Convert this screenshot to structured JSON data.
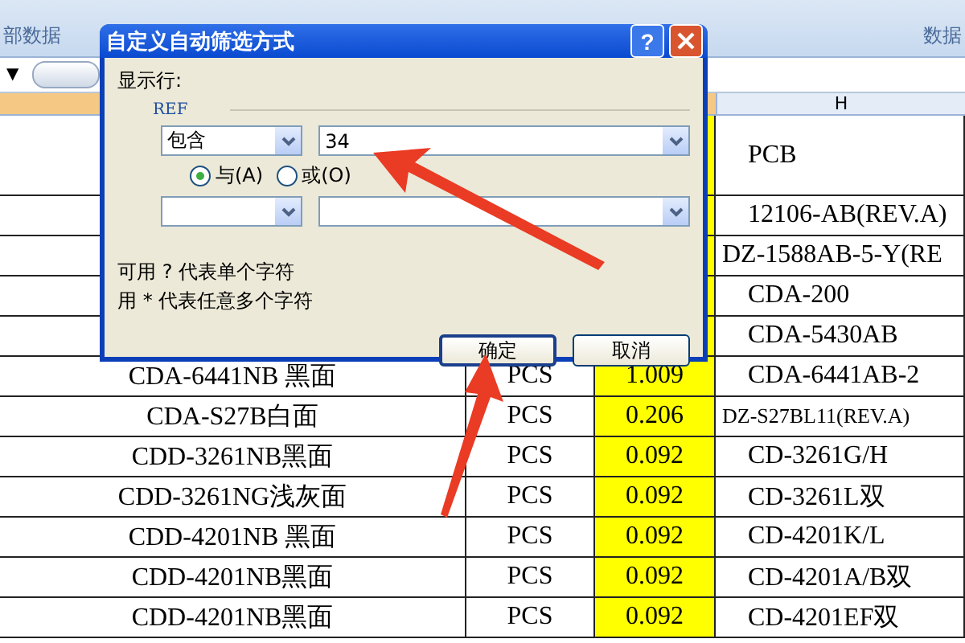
{
  "ribbon": {
    "groups": [
      "部数据",
      "数据"
    ]
  },
  "formula_bar": {
    "name_box_arrow": "▼"
  },
  "sheet": {
    "column_headers": [
      {
        "label": "H"
      }
    ],
    "rows": [
      {
        "column_4": "PCB"
      },
      {
        "column_4": "12106-AB(REV.A)"
      },
      {
        "column_4": "DZ-1588AB-5-Y(RE"
      },
      {
        "column_4": "CDA-200"
      },
      {
        "column_4": "CDA-5430AB"
      },
      {
        "name": "CDA-6441NB 黑面",
        "unit": "PCS",
        "value": "1.009",
        "column_4": "CDA-6441AB-2"
      },
      {
        "name": "CDA-S27B白面",
        "unit": "PCS",
        "value": "0.206",
        "column_4": "DZ-S27BL11(REV.A)"
      },
      {
        "name": "CDD-3261NB黑面",
        "unit": "PCS",
        "value": "0.092",
        "column_4": "CD-3261G/H"
      },
      {
        "name": "CDD-3261NG浅灰面",
        "unit": "PCS",
        "value": "0.092",
        "column_4": "CD-3261L双"
      },
      {
        "name": "CDD-4201NB 黑面",
        "unit": "PCS",
        "value": "0.092",
        "column_4": "CD-4201K/L"
      },
      {
        "name": "CDD-4201NB黑面",
        "unit": "PCS",
        "value": "0.092",
        "column_4": "CD-4201A/B双"
      },
      {
        "name": "CDD-4201NB黑面",
        "unit": "PCS",
        "value": "0.092",
        "column_4": "CD-4201EF双"
      }
    ]
  },
  "dialog": {
    "title": "自定义自动筛选方式",
    "help": "?",
    "group_label": "显示行:",
    "field_label": "REF",
    "conditions": [
      {
        "operator": "包含",
        "value": "34"
      }
    ],
    "logic": [
      {
        "label": "与(A)",
        "selected": true
      },
      {
        "label": "或(O)",
        "selected": false
      }
    ],
    "hints": [
      "可用 ? 代表单个字符",
      "用 * 代表任意多个字符"
    ],
    "buttons": [
      {
        "label": "确定",
        "default": true
      },
      {
        "label": "取消",
        "default": false
      }
    ]
  }
}
